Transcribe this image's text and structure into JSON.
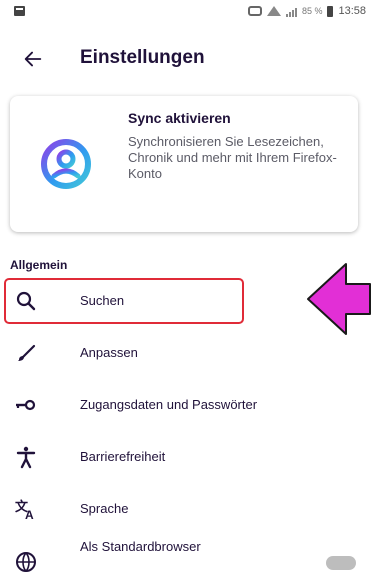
{
  "status_bar": {
    "battery_percent": "85 %",
    "time": "13:58"
  },
  "header": {
    "title": "Einstellungen",
    "back_icon": "back-arrow-icon"
  },
  "sync_card": {
    "title": "Sync aktivieren",
    "description": "Synchronisieren Sie Lesezeichen, Chronik und mehr mit Ihrem Firefox-Konto",
    "avatar_icon": "account-avatar-icon",
    "gradient_colors": [
      "#8f3fe8",
      "#2f9bf0",
      "#42c6d8"
    ]
  },
  "section": {
    "label": "Allgemein"
  },
  "items": [
    {
      "label": "Suchen",
      "icon": "search-icon"
    },
    {
      "label": "Anpassen",
      "icon": "brush-icon"
    },
    {
      "label": "Zugangsdaten und Passwörter",
      "icon": "key-icon"
    },
    {
      "label": "Barrierefreiheit",
      "icon": "accessibility-icon"
    },
    {
      "label": "Sprache",
      "icon": "translate-icon"
    },
    {
      "label": "Als Standardbrowser",
      "icon": "globe-icon"
    }
  ],
  "annotation": {
    "highlight_color": "#e02b38",
    "arrow_color": "#e22fd6"
  }
}
